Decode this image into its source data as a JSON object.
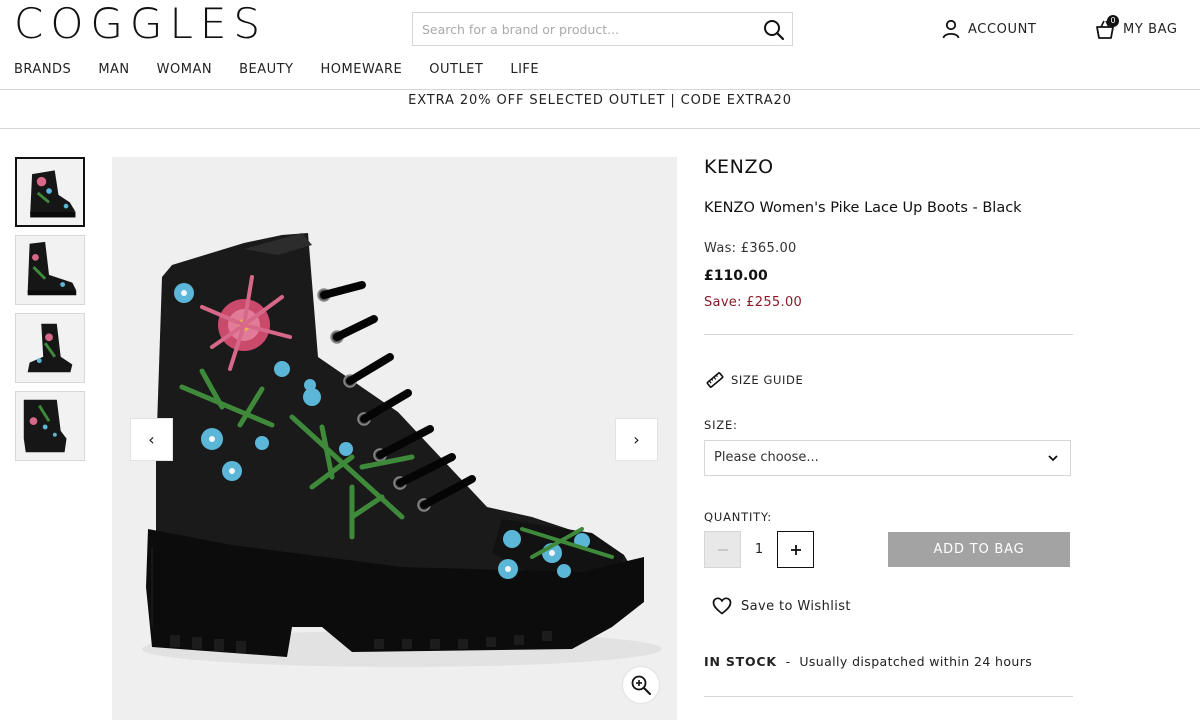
{
  "header": {
    "logo": "COGGLES",
    "search_placeholder": "Search for a brand or product...",
    "account_label": "ACCOUNT",
    "bag_label": "MY BAG",
    "bag_count": "0"
  },
  "nav": {
    "items": [
      "BRANDS",
      "MAN",
      "WOMAN",
      "BEAUTY",
      "HOMEWARE",
      "OUTLET",
      "LIFE"
    ]
  },
  "promo": "EXTRA 20% OFF SELECTED OUTLET | CODE EXTRA20",
  "product": {
    "brand": "KENZO",
    "name": "KENZO Women's Pike Lace Up Boots - Black",
    "was_price": "Was: £365.00",
    "price": "£110.00",
    "save": "Save: £255.00",
    "size_guide_label": "SIZE GUIDE",
    "size_label": "SIZE:",
    "size_value": "Please choose...",
    "quantity_label": "QUANTITY:",
    "quantity_value": "1",
    "add_to_bag_label": "ADD TO BAG",
    "wishlist_label": "Save to Wishlist",
    "stock_status": "IN STOCK",
    "stock_separator": "-",
    "dispatch_text": "Usually dispatched within 24 hours"
  },
  "gallery": {
    "thumbnail_count": 4,
    "active_thumbnail": 1,
    "prev_arrow": "‹",
    "next_arrow": "›"
  },
  "colors": {
    "text": "#222222",
    "save_price": "#8a1a2a",
    "add_button_disabled": "#a3a3a3",
    "image_bg": "#efefef",
    "border": "#d6d6d6"
  },
  "icons": [
    "search-icon",
    "account-icon",
    "bag-icon",
    "ruler-icon",
    "chevron-down-icon",
    "heart-icon",
    "zoom-in-icon",
    "chevron-left-icon",
    "chevron-right-icon"
  ]
}
